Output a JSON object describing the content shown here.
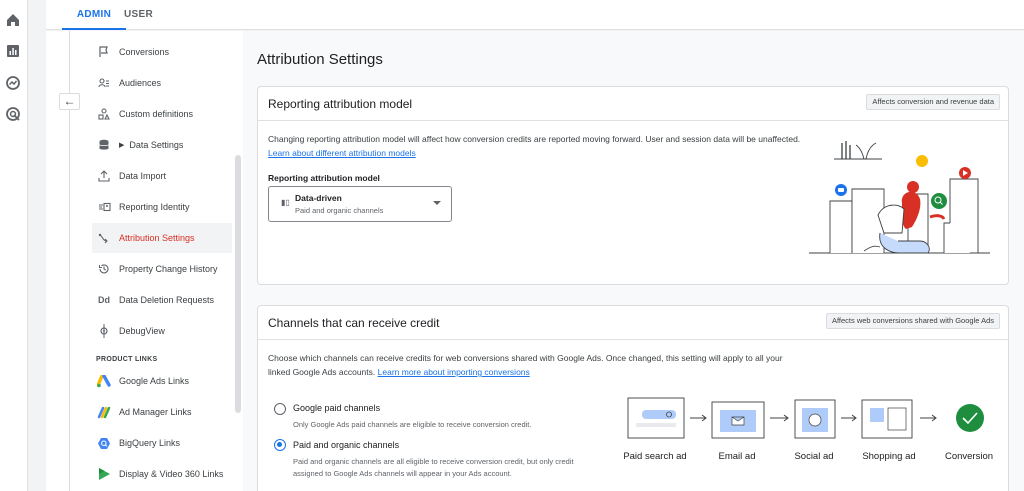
{
  "rail": {
    "icons": [
      "home-icon",
      "reports-icon",
      "explore-icon",
      "advertising-icon"
    ]
  },
  "tabs": [
    {
      "label": "ADMIN",
      "active": true
    },
    {
      "label": "USER",
      "active": false
    }
  ],
  "nav": {
    "items": [
      {
        "label": "Conversions",
        "icon": "flag-icon"
      },
      {
        "label": "Audiences",
        "icon": "audiences-icon"
      },
      {
        "label": "Custom definitions",
        "icon": "custom-definitions-icon"
      },
      {
        "label": "Data Settings",
        "icon": "database-icon"
      },
      {
        "label": "Data Import",
        "icon": "upload-icon"
      },
      {
        "label": "Reporting Identity",
        "icon": "reporting-identity-icon"
      },
      {
        "label": "Attribution Settings",
        "icon": "attribution-icon",
        "active": true
      },
      {
        "label": "Property Change History",
        "icon": "history-icon"
      },
      {
        "label": "Data Deletion Requests",
        "icon": "dd-icon",
        "glyph": "Dd"
      },
      {
        "label": "DebugView",
        "icon": "debug-icon"
      }
    ],
    "section_label": "PRODUCT LINKS",
    "links": [
      {
        "label": "Google Ads Links",
        "icon": "google-ads-icon"
      },
      {
        "label": "Ad Manager Links",
        "icon": "ad-manager-icon"
      },
      {
        "label": "BigQuery Links",
        "icon": "bigquery-icon"
      },
      {
        "label": "Display & Video 360 Links",
        "icon": "dv360-icon"
      }
    ]
  },
  "main": {
    "title": "Attribution Settings",
    "reporting": {
      "title": "Reporting attribution model",
      "chip": "Affects conversion and revenue data",
      "desc": "Changing reporting attribution model will affect how conversion credits are reported moving forward. User and session data will be unaffected.",
      "link": "Learn about different attribution models",
      "field_label": "Reporting attribution model",
      "select_value": "Data-driven",
      "select_sub": "Paid and organic channels"
    },
    "channels": {
      "title": "Channels that can receive credit",
      "chip": "Affects web conversions shared with Google Ads",
      "desc": "Choose which channels can receive credits for web conversions shared with Google Ads. Once changed, this setting will apply to all your linked Google Ads accounts.",
      "link": "Learn more about importing conversions",
      "options": [
        {
          "label": "Google paid channels",
          "sub": "Only Google Ads paid channels are eligible to receive conversion credit.",
          "selected": false
        },
        {
          "label": "Paid and organic channels",
          "sub": "Paid and organic channels are all eligible to receive conversion credit, but only credit assigned to Google Ads channels will appear in your Ads account.",
          "selected": true
        }
      ],
      "flow": [
        "Paid search ad",
        "Email ad",
        "Social ad",
        "Shopping ad",
        "Conversion"
      ]
    }
  },
  "colors": {
    "accent": "#1a73e8",
    "active_nav": "#d93025",
    "success": "#1e8e3e"
  }
}
